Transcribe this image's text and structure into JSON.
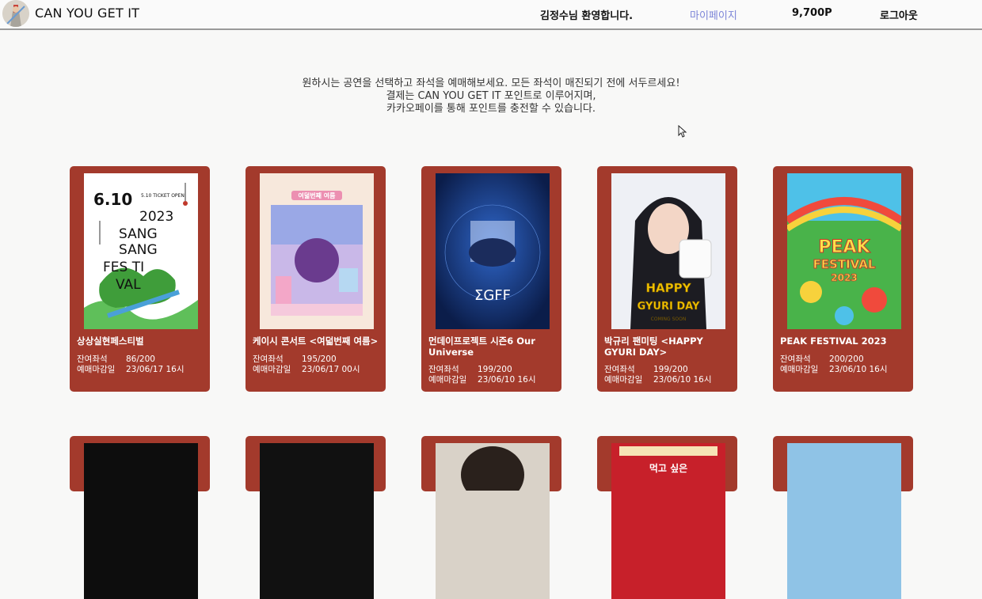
{
  "header": {
    "brand": "CAN YOU GET IT",
    "welcome": "김정수님 환영합니다.",
    "mypage": "마이페이지",
    "points": "9,700P",
    "logout": "로그아웃"
  },
  "intro": {
    "line1": "원하시는 공연을 선택하고 좌석을 예매해보세요. 모든 좌석이 매진되기 전에 서두르세요!",
    "line2": "결제는 CAN YOU GET IT 포인트로 이루어지며,",
    "line3": "카카오페이를 통해 포인트를 충전할 수 있습니다."
  },
  "labels": {
    "remaining": "잔여좌석",
    "deadline": "예매마감일"
  },
  "events": [
    {
      "title": "상상실현페스티벌",
      "remaining": "86/200",
      "deadline": "23/06/17 16시"
    },
    {
      "title": "케이시 콘서트 <여덟번째 여름>",
      "remaining": "195/200",
      "deadline": "23/06/17 00시"
    },
    {
      "title": "먼데이프로젝트 시즌6 Our Universe",
      "remaining": "199/200",
      "deadline": "23/06/10 16시"
    },
    {
      "title": "박규리 팬미팅 <HAPPY GYURI DAY>",
      "remaining": "199/200",
      "deadline": "23/06/10 16시"
    },
    {
      "title": "PEAK FESTIVAL 2023",
      "remaining": "200/200",
      "deadline": "23/06/10 16시"
    }
  ],
  "posters": {
    "p1": {
      "l1": "6.10",
      "l2": "5.10 TICKET OPEN",
      "l3": "2023",
      "l4": "SANG",
      "l5": "SANG",
      "l6": "FES TI",
      "l7": "VAL"
    },
    "p2": {
      "l1": "여덟번째 여름"
    },
    "p3": {
      "l1": "ΣGFF"
    },
    "p4": {
      "l1": "HAPPY",
      "l2": "GYURI DAY",
      "l3": "COMING SOON"
    },
    "p5": {
      "l1": "PEAK",
      "l2": "FESTIVAL",
      "l3": "2023"
    },
    "p9": {
      "l1": "먹고 싶은"
    }
  }
}
